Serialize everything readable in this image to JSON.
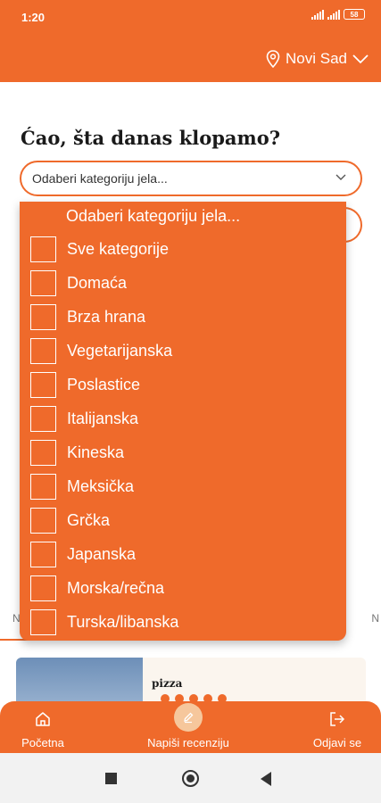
{
  "status_bar": {
    "time": "1:20",
    "battery": "58"
  },
  "header": {
    "location": "Novi Sad"
  },
  "greeting": "Ćao, šta danas klopamo?",
  "category_select": {
    "placeholder": "Odaberi kategoriju jela..."
  },
  "dropdown": {
    "header": "Odaberi kategoriju jela...",
    "items": [
      "Sve kategorije",
      "Domaća",
      "Brza hrana",
      "Vegetarijanska",
      "Poslastice",
      "Italijanska",
      "Kineska",
      "Meksička",
      "Grčka",
      "Japanska",
      "Morska/rečna",
      "Turska/libanska"
    ]
  },
  "background": {
    "side_left": "N",
    "side_right": "N",
    "card_title": "pizza"
  },
  "bottom_nav": {
    "home_label": "Početna",
    "review_label": "Napiši recenziju",
    "logout_label": "Odjavi se"
  },
  "colors": {
    "accent": "#ef6a2b"
  }
}
